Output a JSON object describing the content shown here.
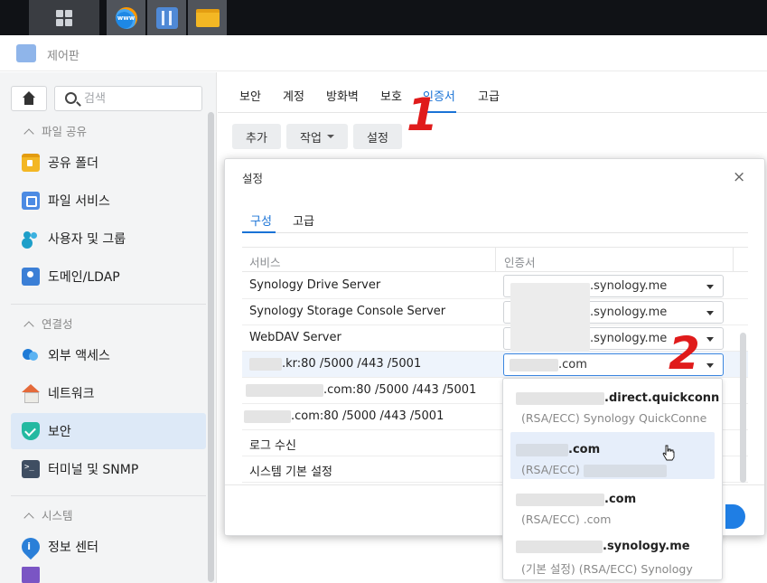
{
  "window": {
    "title": "제어판"
  },
  "sidebar": {
    "search_placeholder": "검색",
    "sections": [
      {
        "label": "파일 공유"
      },
      {
        "label": "연결성"
      },
      {
        "label": "시스템"
      }
    ],
    "items": [
      {
        "label": "공유 폴더",
        "icon": "shared-folder-icon"
      },
      {
        "label": "파일 서비스",
        "icon": "file-services-icon"
      },
      {
        "label": "사용자 및 그룹",
        "icon": "users-icon"
      },
      {
        "label": "도메인/LDAP",
        "icon": "ldap-icon"
      },
      {
        "label": "외부 액세스",
        "icon": "external-access-icon"
      },
      {
        "label": "네트워크",
        "icon": "network-icon"
      },
      {
        "label": "보안",
        "icon": "security-icon",
        "active": true
      },
      {
        "label": "터미널 및 SNMP",
        "icon": "terminal-icon"
      },
      {
        "label": "정보 센터",
        "icon": "info-center-icon"
      }
    ]
  },
  "main": {
    "tabs": [
      "보안",
      "계정",
      "방화벽",
      "보호",
      "인증서",
      "고급"
    ],
    "active_tab": "인증서",
    "toolbar": {
      "add": "추가",
      "action": "작업",
      "settings": "설정"
    }
  },
  "annotations": {
    "one": "1",
    "two": "2"
  },
  "dialog": {
    "title": "설정",
    "close": "×",
    "tabs": [
      "구성",
      "고급"
    ],
    "columns": {
      "service": "서비스",
      "certificate": "인증서"
    },
    "rows": [
      {
        "service": "Synology Drive Server",
        "cert": ".synology.me"
      },
      {
        "service": "Synology Storage Console Server",
        "cert": ".synology.me"
      },
      {
        "service": "WebDAV Server",
        "cert": ".synology.me"
      },
      {
        "service": ".kr:80 /5000 /443 /5001",
        "cert": ".com"
      },
      {
        "service": ".com:80 /5000 /443 /5001",
        "cert": ""
      },
      {
        "service": ".com:80 /5000 /443 /5001",
        "cert": ""
      },
      {
        "service": "로그 수신",
        "cert": ""
      },
      {
        "service": "시스템 기본 설정",
        "cert": ""
      }
    ]
  },
  "dropdown": {
    "options": [
      {
        "name": ".direct.quickconn",
        "detail": "(RSA/ECC) Synology QuickConne"
      },
      {
        "name": ".com",
        "detail": "(RSA/ECC)"
      },
      {
        "name": ".com",
        "detail": "(RSA/ECC) .com"
      },
      {
        "name": ".synology.me",
        "detail": "(기본 설정) (RSA/ECC) Synology"
      }
    ]
  },
  "colors": {
    "accent": "#1a73d6",
    "annotation": "#e01b1b",
    "active_item": "#dde9f7"
  }
}
